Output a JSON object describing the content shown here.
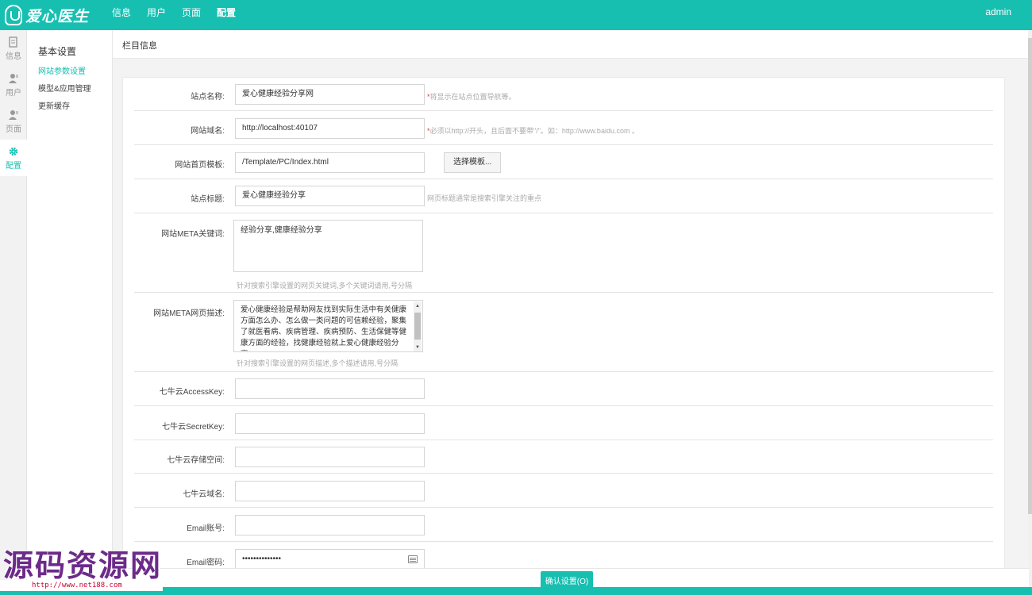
{
  "brand": {
    "logo_text": "爱心医生"
  },
  "topnav": {
    "items": [
      "信息",
      "用户",
      "页面",
      "配置"
    ],
    "active_index": 3
  },
  "user": {
    "name": "admin"
  },
  "rail": {
    "items": [
      {
        "label": "信息",
        "icon": "document-icon"
      },
      {
        "label": "用户",
        "icon": "user-icon"
      },
      {
        "label": "页面",
        "icon": "page-user-icon"
      },
      {
        "label": "配置",
        "icon": "gear-icon"
      }
    ],
    "active_index": 3
  },
  "subnav": {
    "heading": "基本设置",
    "items": [
      "网站参数设置",
      "模型&应用管理",
      "更新缓存"
    ],
    "active_index": 0
  },
  "breadcrumb": {
    "title": "栏目信息"
  },
  "form": {
    "site_name": {
      "label": "站点名称:",
      "value": "爱心健康经验分享网",
      "hint_req": "*",
      "hint": "将显示在站点位置导航等。"
    },
    "domain": {
      "label": "网站域名:",
      "value": "http://localhost:40107",
      "hint_req": "*",
      "hint": "必须以http://开头，且后面不要带\"/\"。如：http://www.baidu.com 。"
    },
    "template": {
      "label": "网站首页模板:",
      "value": "/Template/PC/Index.html",
      "button": "选择模板..."
    },
    "site_title": {
      "label": "站点标题:",
      "value": "爱心健康经验分享",
      "hint": "网页标题通常是搜索引擎关注的重点"
    },
    "meta_keywords": {
      "label": "网站META关键词:",
      "value": "经验分享,健康经验分享",
      "hint": "针对搜索引擎设置的网页关键词,多个关键词请用,号分隔"
    },
    "meta_desc": {
      "label": "网站META网页描述:",
      "value": "爱心健康经验是帮助网友找到实际生活中有关健康方面怎么办、怎么做一类问题的可信赖经验，聚集了就医看病、疾病管理、疾病预防、生活保健等健康方面的经验，找健康经验就上爱心健康经验分享。",
      "hint": "针对搜索引擎设置的网页描述,多个描述请用,号分隔"
    },
    "qiniu_access": {
      "label": "七牛云AccessKey:",
      "value": ""
    },
    "qiniu_secret": {
      "label": "七牛云SecretKey:",
      "value": ""
    },
    "qiniu_bucket": {
      "label": "七牛云存储空间:",
      "value": ""
    },
    "qiniu_domain": {
      "label": "七牛云域名:",
      "value": ""
    },
    "email_account": {
      "label": "Email账号:",
      "value": ""
    },
    "email_password": {
      "label": "Email密码:",
      "value": "••••••••••••••"
    }
  },
  "footer": {
    "submit_label": "确认设置(O)"
  },
  "watermark": {
    "text": "源码资源网",
    "url": "http://www.net188.com"
  },
  "colors": {
    "accent": "#17bfb1",
    "required": "#ee3333",
    "watermark": "#6c2a8a"
  }
}
